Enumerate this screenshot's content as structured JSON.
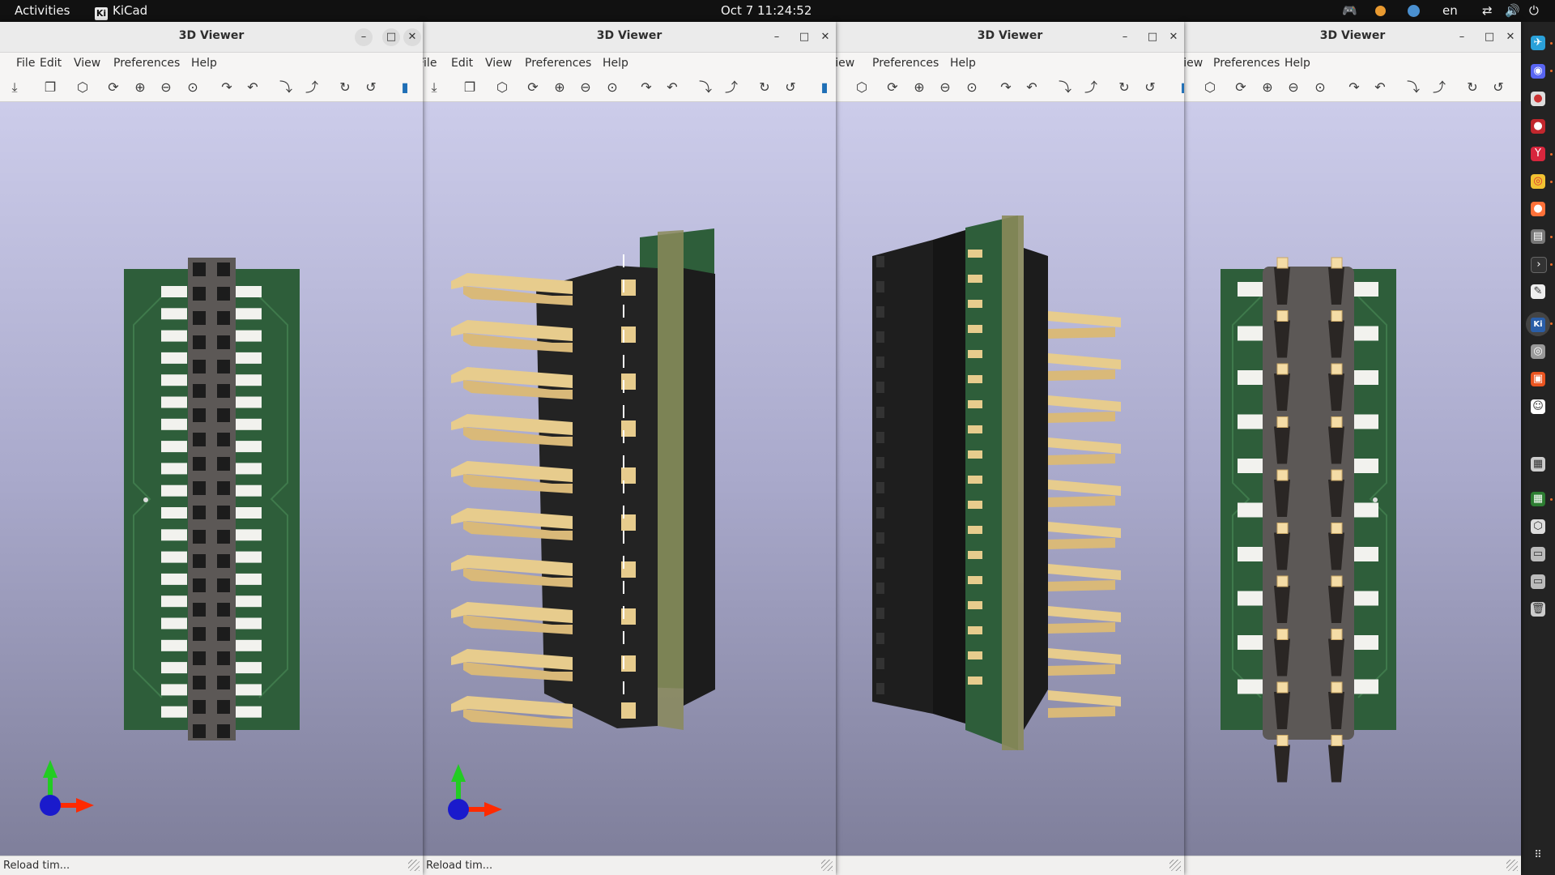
{
  "topbar": {
    "activities": "Activities",
    "app_name": "KiCad",
    "app_logo_text": "Ki",
    "clock": "Oct 7  11:24:52",
    "language": "en"
  },
  "windows": [
    {
      "title": "3D Viewer",
      "menu": [
        "File",
        "Edit",
        "View",
        "Preferences",
        "Help"
      ],
      "status": "Reload tim...",
      "view": "top"
    },
    {
      "title": "3D Viewer",
      "menu": [
        "File",
        "Edit",
        "View",
        "Preferences",
        "Help"
      ],
      "status": "Reload tim...",
      "view": "iso-left"
    },
    {
      "title": "3D Viewer",
      "menu": [
        "View",
        "Preferences",
        "Help"
      ],
      "status": "",
      "view": "iso-right"
    },
    {
      "title": "3D Viewer",
      "menu": [
        "View",
        "Preferences",
        "Help"
      ],
      "status": "",
      "view": "bottom"
    }
  ],
  "toolbar_icons": [
    "reload-icon",
    "copy-icon",
    "view-3d-icon",
    "refresh-icon",
    "zoom-in-icon",
    "zoom-out-icon",
    "zoom-fit-icon",
    "rotate-x-cw-icon",
    "rotate-x-ccw-icon",
    "rotate-y-cw-icon",
    "rotate-y-ccw-icon",
    "rotate-z-cw-icon",
    "rotate-z-ccw-icon",
    "ortho-toggle-icon"
  ],
  "colors": {
    "pcb": "#2e5e3a",
    "pad": "#f2f2ee",
    "connector_body": "#5c5856",
    "pin_gold": "#e7cc8d",
    "housing_black": "#232323",
    "axis_x": "#ff2a00",
    "axis_y": "#22cc22",
    "axis_z": "#1a1acc"
  }
}
